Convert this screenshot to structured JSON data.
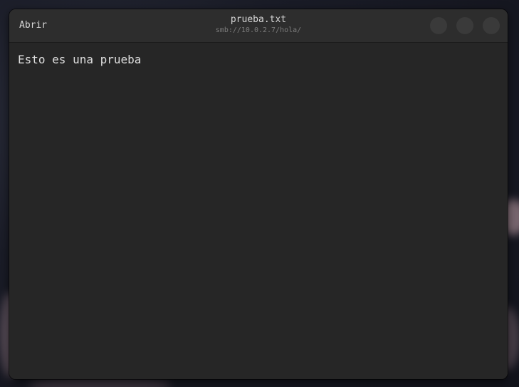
{
  "window": {
    "title": "prueba.txt",
    "subtitle": "smb://10.0.2.7/hola/"
  },
  "headerbar": {
    "open_label": "Abrir",
    "buttons": [
      {
        "name": "minimize",
        "icon": "minimize-icon"
      },
      {
        "name": "maximize",
        "icon": "maximize-icon"
      },
      {
        "name": "close",
        "icon": "close-icon"
      }
    ]
  },
  "editor": {
    "content": "Esto es una prueba"
  },
  "colors": {
    "window_bg": "#262626",
    "headerbar_bg": "#2d2d2d",
    "button_bg": "#3a3a3a",
    "text": "#dedede",
    "subtitle": "#7c7c7c"
  }
}
